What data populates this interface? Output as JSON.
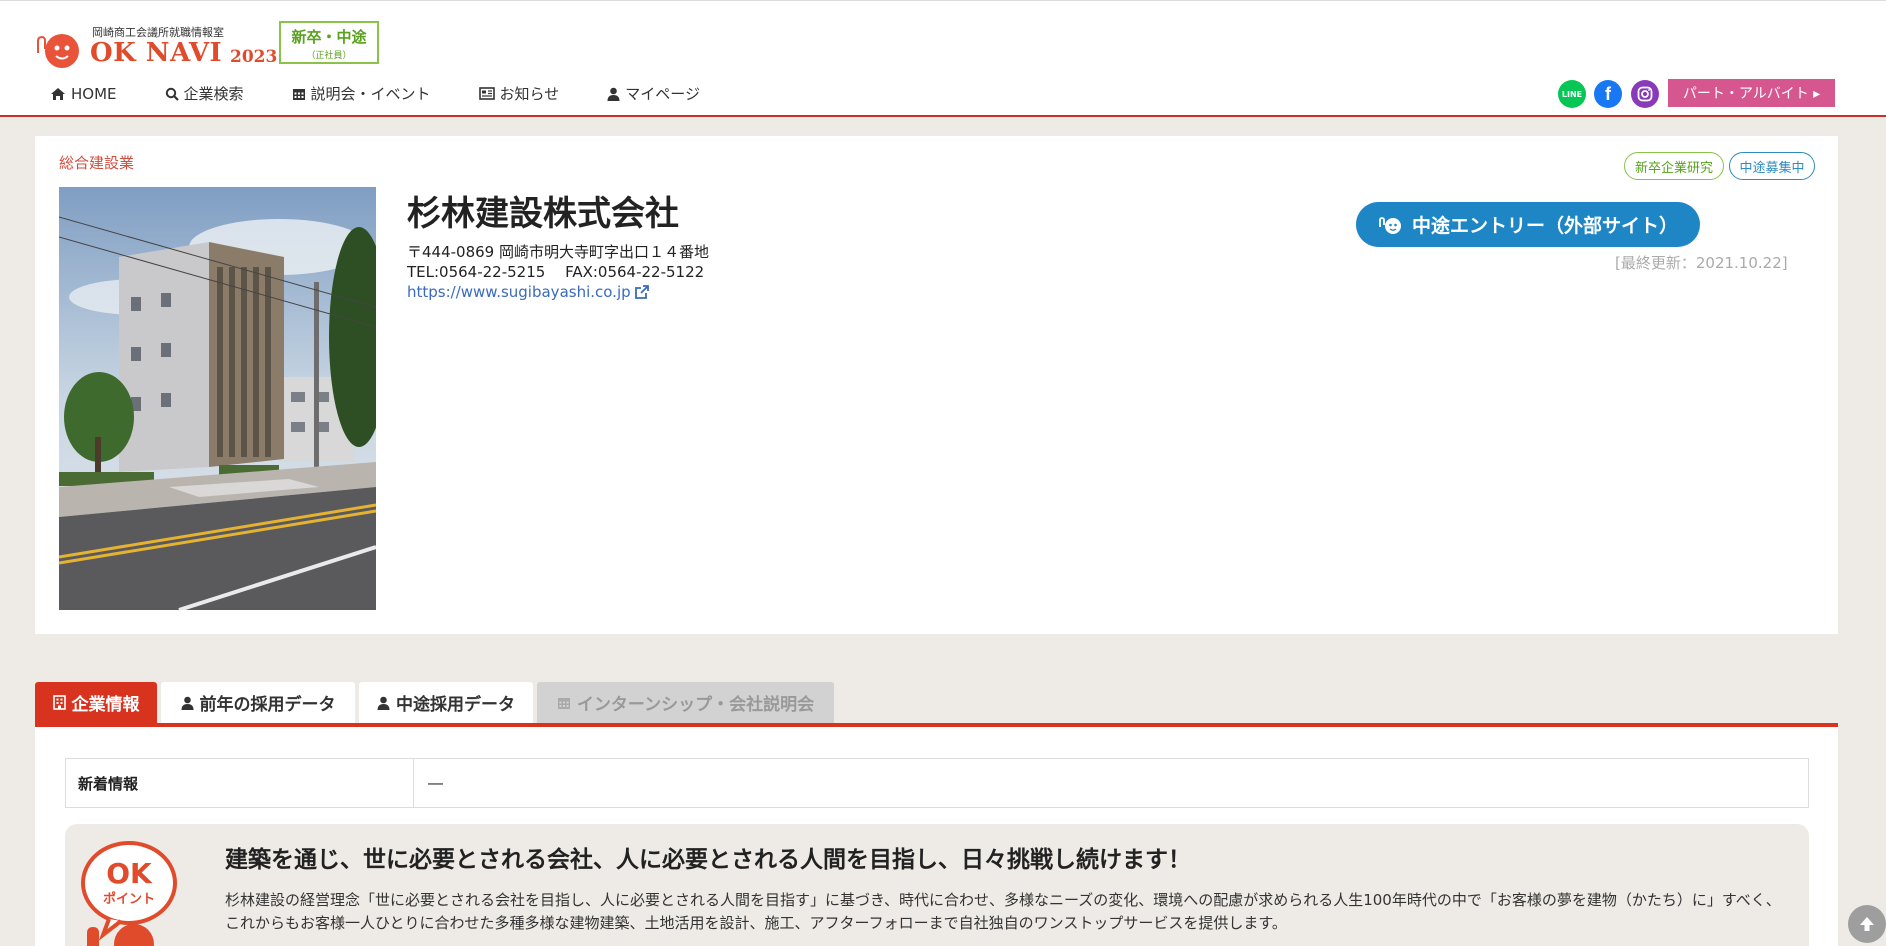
{
  "header": {
    "logo_subtitle": "岡崎商工会議所就職情報室",
    "logo_title": "OK NAVI",
    "logo_year": "2023",
    "badge_main": "新卒・中途",
    "badge_sub": "（正社員）",
    "nav": [
      {
        "label": "HOME",
        "icon": "home-icon"
      },
      {
        "label": "企業検索",
        "icon": "search-icon"
      },
      {
        "label": "説明会・イベント",
        "icon": "calendar-icon"
      },
      {
        "label": "お知らせ",
        "icon": "newspaper-icon"
      },
      {
        "label": "マイページ",
        "icon": "user-icon"
      }
    ],
    "sns_line": "LINE",
    "sns_facebook": "f",
    "part_button": "パート・アルバイト ▸"
  },
  "company": {
    "industry": "総合建設業",
    "name": "杉林建設株式会社",
    "address": "〒444-0869 岡崎市明大寺町字出口１４番地",
    "tel_fax": "TEL:0564-22-5215　 FAX:0564-22-5122",
    "url": "https://www.sugibayashi.co.jp",
    "tags": [
      "新卒企業研究",
      "中途募集中"
    ],
    "entry_button": "中途エントリー（外部サイト）",
    "updated": "[最終更新：2021.10.22]"
  },
  "tabs": [
    {
      "label": "企業情報",
      "icon": "building-icon",
      "active": true
    },
    {
      "label": "前年の採用データ",
      "icon": "user-icon"
    },
    {
      "label": "中途採用データ",
      "icon": "user-icon"
    },
    {
      "label": "インターンシップ・会社説明会",
      "icon": "calendar-icon",
      "disabled": true
    }
  ],
  "news": {
    "header": "新着情報",
    "value": "―"
  },
  "ok_point": {
    "mascot_text": "OK",
    "mascot_sub": "ポイント",
    "title": "建築を通じ、世に必要とされる会社、人に必要とされる人間を目指し、日々挑戦し続けます！",
    "body": "杉林建設の経営理念「世に必要とされる会社を目指し、人に必要とされる人間を目指す」に基づき、時代に合わせ、多様なニーズの変化、環境への配慮が求められる人生100年時代の中で「お客様の夢を建物（かたち）に」すべく、これからもお客様一人ひとりに合わせた多種多様な建物建築、土地活用を設計、施工、アフターフォローまで自社独自のワンストップサービスを提供します。"
  },
  "colors": {
    "accent": "#d8331f",
    "entry_blue": "#1f86c6",
    "part_pink": "#d6578f",
    "green": "#8bc34a"
  }
}
